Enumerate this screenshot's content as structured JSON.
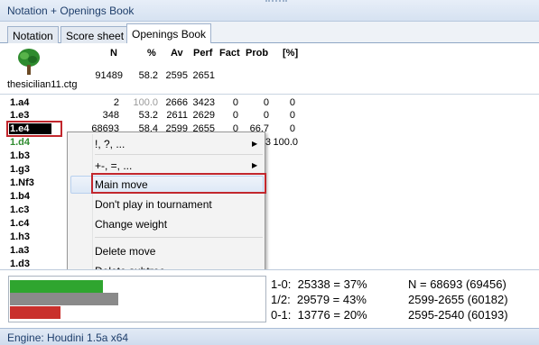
{
  "window": {
    "title": "Notation + Openings Book"
  },
  "tabs": [
    {
      "label": "Notation"
    },
    {
      "label": "Score sheet"
    },
    {
      "label": "Openings Book",
      "active": true
    }
  ],
  "book": {
    "headers": {
      "n": "N",
      "pct": "%",
      "av": "Av",
      "perf": "Perf",
      "fact": "Fact",
      "prob": "Prob",
      "z": "[%]"
    },
    "file_name": "thesicilian11.ctg",
    "summary": {
      "n": "91489",
      "pct": "58.2",
      "av": "2595",
      "perf": "2651"
    },
    "rows": [
      {
        "move": "1.a4",
        "n": "2",
        "pct": "100.0",
        "av": "2666",
        "perf": "3423",
        "fact": "0",
        "prob": "0",
        "z": "0"
      },
      {
        "move": "1.e3",
        "n": "348",
        "pct": "53.2",
        "av": "2611",
        "perf": "2629",
        "fact": "0",
        "prob": "0",
        "z": "0"
      },
      {
        "move": "1.e4",
        "n": "68693",
        "pct": "58.4",
        "av": "2599",
        "perf": "2655",
        "fact": "0",
        "prob": "66.7",
        "z": "0"
      },
      {
        "move": "1.d4",
        "prob": "3",
        "z": "100.0"
      },
      {
        "move": "1.b3"
      },
      {
        "move": "1.g3"
      },
      {
        "move": "1.Nf3"
      },
      {
        "move": "1.b4"
      },
      {
        "move": "1.c3"
      },
      {
        "move": "1.c4"
      },
      {
        "move": "1.h3"
      },
      {
        "move": "1.a3"
      },
      {
        "move": "1.d3"
      }
    ]
  },
  "context_menu": {
    "items": [
      {
        "label": "!, ?, ...",
        "submenu": true
      },
      {
        "label": "+-, =, ...",
        "submenu": true
      },
      {
        "label": "Main move"
      },
      {
        "label": "Don't play in tournament"
      },
      {
        "label": "Change weight"
      },
      {
        "label": "Delete move"
      },
      {
        "label": "Delete subtree"
      }
    ]
  },
  "stats": {
    "results": {
      "win": "1-0:  25338 = 37%",
      "draw": "1/2:  29579 = 43%",
      "loss": "0-1:  13776 = 20%"
    },
    "right": {
      "line1": "N = 68693 (69456)",
      "line2": "2599-2655 (60182)",
      "line3": "2595-2540 (60193)"
    },
    "bars": [
      {
        "name": "win",
        "fraction": 0.37,
        "color": "#2fa52f"
      },
      {
        "name": "draw",
        "fraction": 0.43,
        "color": "#8a8a8a"
      },
      {
        "name": "loss",
        "fraction": 0.2,
        "color": "#c9302c"
      }
    ]
  },
  "status": {
    "engine": "Engine: Houdini 1.5a x64"
  },
  "icons": {
    "book_icon": "tree-icon",
    "submenu_arrow": "triangle-right-icon"
  }
}
